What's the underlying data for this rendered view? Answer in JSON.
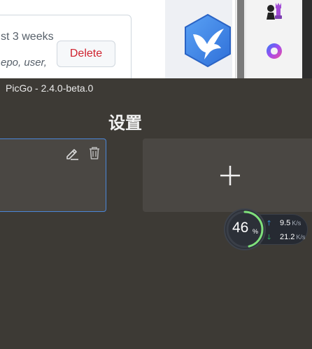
{
  "background_browser": {
    "repo_card": {
      "updated_text": "st 3 weeks",
      "topics_text": "epo, user,",
      "delete_label": "Delete"
    },
    "colors": {
      "delete_text": "#cf222e",
      "app_logo": "#3b82e6"
    },
    "icons": [
      "hummingbird-app-icon",
      "chess-extension-icon",
      "copilot-extension-icon"
    ]
  },
  "window": {
    "title": "PicGo - 2.4.0-beta.0"
  },
  "page": {
    "title": "设置"
  },
  "config_card": {
    "icons": [
      "edit-icon",
      "trash-icon"
    ],
    "accent": "#4a86d8"
  },
  "add_card": {
    "icon": "plus-icon"
  },
  "speed_widget": {
    "cpu_value": "46",
    "cpu_unit": "%",
    "cpu_fraction": 0.46,
    "upload": {
      "value": "9.5",
      "unit": "K/s"
    },
    "download": {
      "value": "21.2",
      "unit": "K/s"
    },
    "colors": {
      "ring": "#7ee07a",
      "up": "#3fb0ff",
      "down": "#2fd36a"
    }
  }
}
